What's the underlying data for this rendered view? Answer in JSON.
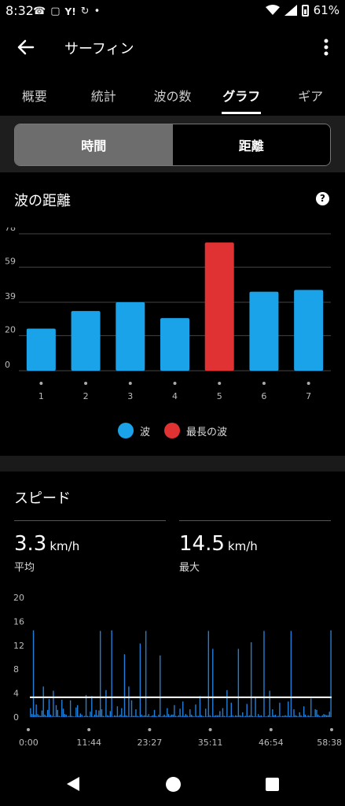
{
  "status_bar": {
    "time": "8:32",
    "battery": "61%",
    "icons_left": [
      "missed-call-icon",
      "copy-icon",
      "yahoo-icon",
      "sync-icon",
      "dot-icon"
    ],
    "icons_right": [
      "wifi-icon",
      "signal-icon",
      "battery-icon"
    ]
  },
  "appbar": {
    "title": "サーフィン"
  },
  "tabs": [
    {
      "label": "概要",
      "active": false
    },
    {
      "label": "統計",
      "active": false
    },
    {
      "label": "波の数",
      "active": false
    },
    {
      "label": "グラフ",
      "active": true
    },
    {
      "label": "ギア",
      "active": false
    }
  ],
  "segment": {
    "left": "時間",
    "right": "距離",
    "selected": "時間"
  },
  "wave_card": {
    "title": "波の距離",
    "legend": [
      {
        "label": "波",
        "color": "#1aa3e8"
      },
      {
        "label": "最長の波",
        "color": "#e03232"
      }
    ]
  },
  "speed_card": {
    "title": "スピード",
    "avg_value": "3.3",
    "avg_unit": "km/h",
    "avg_label": "平均",
    "max_value": "14.5",
    "max_unit": "km/h",
    "max_label": "最大"
  },
  "chart_data": [
    {
      "type": "bar",
      "categories": [
        "1",
        "2",
        "3",
        "4",
        "5",
        "6",
        "7"
      ],
      "values": [
        24,
        34,
        39,
        30,
        73,
        45,
        46
      ],
      "highlight_index": 4,
      "colors": {
        "normal": "#1aa3e8",
        "highlight": "#e03232"
      },
      "yticks": [
        0,
        20,
        39,
        59,
        78
      ],
      "ylim": [
        0,
        78
      ],
      "grid": true
    },
    {
      "type": "bar",
      "xticks": [
        "0:00",
        "11:44",
        "23:27",
        "35:11",
        "46:54",
        "58:38"
      ],
      "yticks": [
        0,
        4,
        8,
        12,
        16,
        20
      ],
      "ylim": [
        0,
        20
      ],
      "average": 3.3,
      "max": 14.5,
      "color": "#1f7fd9",
      "values": [
        1.5,
        0.5,
        14.5,
        0.4,
        2.1,
        0.5,
        0.3,
        0.2,
        1.1,
        5.1,
        0.4,
        0.2,
        1.2,
        3.0,
        0.4,
        0.2,
        4.4,
        0.1,
        2.0,
        1.2,
        0.2,
        0.1,
        2.9,
        1.4,
        0.5,
        0.4,
        0.1,
        0.2,
        2.8,
        0.2,
        0.1,
        0.1,
        1.6,
        2.0,
        0.2,
        0.6,
        0.4,
        0.1,
        0.2,
        3.7,
        0.2,
        0.1,
        0.9,
        3.5,
        0.1,
        0.4,
        1.2,
        0.3,
        1.1,
        14.4,
        1.3,
        0.2,
        0.1,
        4.5,
        0.3,
        0.2,
        1.0,
        14.5,
        0.1,
        0.3,
        0.2,
        1.8,
        0.2,
        0.4,
        1.5,
        0.2,
        10.5,
        0.3,
        0.2,
        5.1,
        0.1,
        2.8,
        0.2,
        0.2,
        1.3,
        0.2,
        0.1,
        12.3,
        0.4,
        0.2,
        0.3,
        14.4,
        0.2,
        0.5,
        0.1,
        0.2,
        0.3,
        1.2,
        0.2,
        0.1,
        0.4,
        10.3,
        0.1,
        0.2,
        0.4,
        0.2,
        1.5,
        0.5,
        0.2,
        0.4,
        0.4,
        2.0,
        0.2,
        0.1,
        0.3,
        1.4,
        0.2,
        2.6,
        0.2,
        0.5,
        0.3,
        0.1,
        1.3,
        0.4,
        0.2,
        0.1,
        2.1,
        0.2,
        0.2,
        3.5,
        0.3,
        0.2,
        0.1,
        1.4,
        0.1,
        14.4,
        0.3,
        0.1,
        11.4,
        0.2,
        0.3,
        0.3,
        0.3,
        1.0,
        0.1,
        1.5,
        0.2,
        0.1,
        4.5,
        0.1,
        0.2,
        2.4,
        0.3,
        0.1,
        0.3,
        0.2,
        11.4,
        0.3,
        0.2,
        0.8,
        0.1,
        0.2,
        2.2,
        0.2,
        0.3,
        12.5,
        0.2,
        0.1,
        3.3,
        0.1,
        0.5,
        0.2,
        0.3,
        0.1,
        14.4,
        0.1,
        0.1,
        0.3,
        4.4,
        0.1,
        1.3,
        0.3,
        0.4,
        0.1,
        0.2,
        2.4,
        0.1,
        0.2,
        0.2,
        0.3,
        0.2,
        2.6,
        0.2,
        14.4,
        0.1,
        1.3,
        0.3,
        0.2,
        0.1,
        0.8,
        0.3,
        0.1,
        1.8,
        0.4,
        0.1,
        0.3,
        0.2,
        3.1,
        0.1,
        0.1,
        1.3,
        1.2,
        0.4,
        0.2,
        0.1,
        0.3,
        0.5,
        0.4,
        0.3,
        0.3,
        0.9,
        14.5
      ]
    }
  ]
}
